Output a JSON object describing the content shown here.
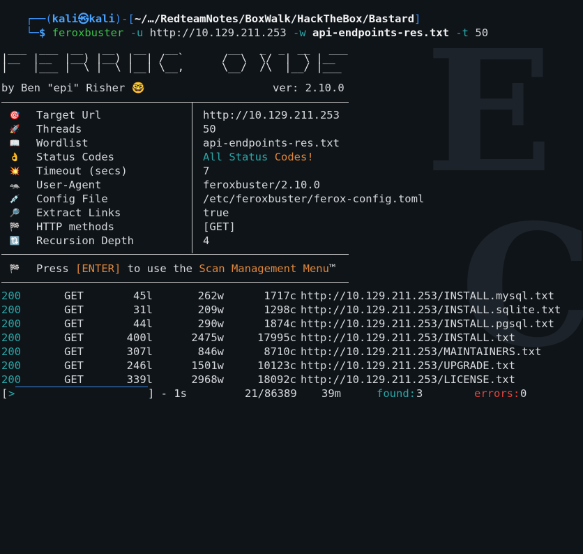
{
  "prompt": {
    "user": "kali",
    "host": "kali",
    "path": "~/…/RedteamNotes/BoxWalk/HackTheBox/Bastard",
    "command": "feroxbuster",
    "flag_u": "-u",
    "url": "http://10.129.211.253",
    "flag_w": "-w",
    "wordlist": "api-endpoints-res.txt",
    "flag_t": "-t",
    "threads": "50"
  },
  "banner": {
    "ascii": " ___  ___  __   __   __   __        __   _  _  __   ___\n|__  |__  |__) |__) |  | /  `      /  \\  \\/  |  \\ |__\n|    |___ |  \\ |  \\ |__| \\__,      \\__/  /\\  |__/ |___",
    "author": "by Ben \"epi\" Risher 🤓",
    "version": "ver: 2.10.0"
  },
  "config": [
    {
      "icon": "🎯",
      "icon_name": "target-icon",
      "key": "Target Url",
      "value": "http://10.129.211.253"
    },
    {
      "icon": "🚀",
      "icon_name": "rocket-icon",
      "key": "Threads",
      "value": "50"
    },
    {
      "icon": "📖",
      "icon_name": "book-icon",
      "key": "Wordlist",
      "value": "api-endpoints-res.txt"
    },
    {
      "icon": "👌",
      "icon_name": "ok-hand-icon",
      "key": "Status Codes",
      "value_parts": [
        "All",
        "Status",
        "Codes!"
      ]
    },
    {
      "icon": "💥",
      "icon_name": "collision-icon",
      "key": "Timeout (secs)",
      "value": "7"
    },
    {
      "icon": "🦡",
      "icon_name": "badger-icon",
      "key": "User-Agent",
      "value": "feroxbuster/2.10.0"
    },
    {
      "icon": "💉",
      "icon_name": "syringe-icon",
      "key": "Config File",
      "value": "/etc/feroxbuster/ferox-config.toml"
    },
    {
      "icon": "🔎",
      "icon_name": "magnifier-icon",
      "key": "Extract Links",
      "value": "true"
    },
    {
      "icon": "🏁",
      "icon_name": "checkered-flag-icon",
      "key": "HTTP methods",
      "value": "[GET]"
    },
    {
      "icon": "🔃",
      "icon_name": "recursion-icon",
      "key": "Recursion Depth",
      "value": "4"
    }
  ],
  "menu_hint": {
    "icon": "🏁",
    "pre": "Press ",
    "key": "[ENTER]",
    "mid": " to use the ",
    "menu": "Scan Management Menu",
    "tm": "™"
  },
  "results": [
    {
      "status": "200",
      "method": "GET",
      "lines": "45l",
      "words": "262w",
      "chars": "1717c",
      "url": "http://10.129.211.253/INSTALL.mysql.txt"
    },
    {
      "status": "200",
      "method": "GET",
      "lines": "31l",
      "words": "209w",
      "chars": "1298c",
      "url": "http://10.129.211.253/INSTALL.sqlite.txt"
    },
    {
      "status": "200",
      "method": "GET",
      "lines": "44l",
      "words": "290w",
      "chars": "1874c",
      "url": "http://10.129.211.253/INSTALL.pgsql.txt"
    },
    {
      "status": "200",
      "method": "GET",
      "lines": "400l",
      "words": "2475w",
      "chars": "17995c",
      "url": "http://10.129.211.253/INSTALL.txt"
    },
    {
      "status": "200",
      "method": "GET",
      "lines": "307l",
      "words": "846w",
      "chars": "8710c",
      "url": "http://10.129.211.253/MAINTAINERS.txt"
    },
    {
      "status": "200",
      "method": "GET",
      "lines": "246l",
      "words": "1501w",
      "chars": "10123c",
      "url": "http://10.129.211.253/UPGRADE.txt"
    },
    {
      "status": "200",
      "method": "GET",
      "lines": "339l",
      "words": "2968w",
      "chars": "18092c",
      "url": "http://10.129.211.253/LICENSE.txt"
    }
  ],
  "progress": {
    "open": "[",
    "arrow": ">",
    "close": "] - 1s",
    "count": "21/86389",
    "eta": "39m",
    "found_label": "found:",
    "found": "3",
    "errors_label": "errors:",
    "errors": "0"
  }
}
